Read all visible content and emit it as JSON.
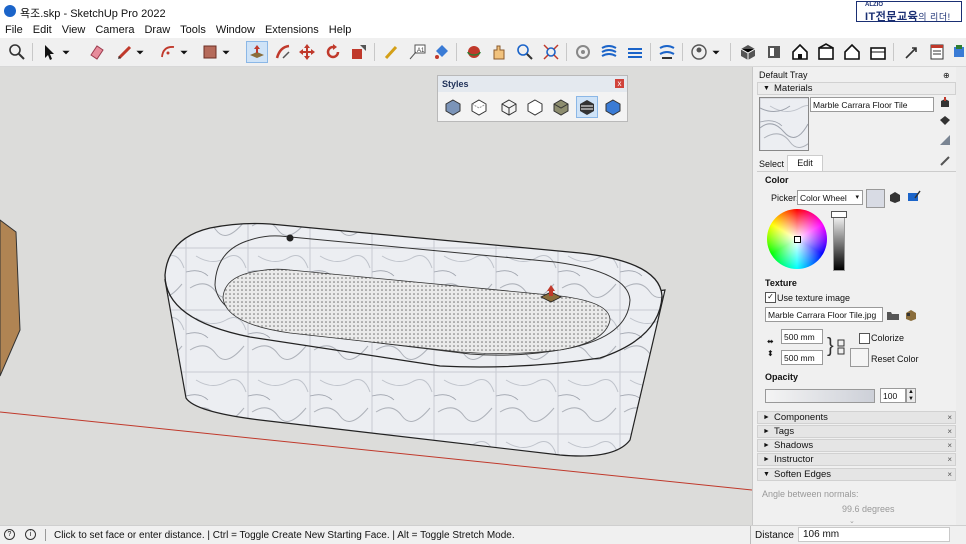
{
  "window": {
    "title": "욕조.skp - SketchUp Pro 2022"
  },
  "brand": {
    "top": "ALZIO",
    "main": "IT전문교육",
    "sub": "의 리더!"
  },
  "menu": [
    "File",
    "Edit",
    "View",
    "Camera",
    "Draw",
    "Tools",
    "Window",
    "Extensions",
    "Help"
  ],
  "toolbar_icons": [
    "zoom-icon",
    "select-icon",
    "eraser-icon",
    "pencil-icon",
    "arc-icon",
    "shape-icon",
    "push-pull-icon",
    "follow-me-icon",
    "move-icon",
    "rotate-icon",
    "scale-icon",
    "tape-measure-icon",
    "text-icon",
    "paint-bucket-icon",
    "orbit-icon",
    "pan-icon",
    "zoom-tool-icon",
    "zoom-extents-icon",
    "sandbox-icon",
    "sandbox-drape-icon",
    "sandbox-stamp-icon",
    "sandbox-flip-icon",
    "profile-icon",
    "iso-view-icon",
    "top-view-icon",
    "front-view-icon",
    "right-view-icon",
    "back-view-icon",
    "left-view-icon",
    "warehouse-icon",
    "extension-icon"
  ],
  "styles_panel": {
    "title": "Styles",
    "close": "x"
  },
  "tray": {
    "title": "Default Tray",
    "pin": "⊕",
    "materials_header": "Materials",
    "material_name": "Marble Carrara Floor Tile",
    "tabs": {
      "select": "Select",
      "edit": "Edit"
    },
    "color_label": "Color",
    "picker_label": "Picker:",
    "picker_value": "Color Wheel",
    "texture_label": "Texture",
    "use_texture": "Use texture image",
    "texture_file": "Marble Carrara Floor Tile.jpg",
    "width": "500 mm",
    "height": "500 mm",
    "colorize": "Colorize",
    "reset_color": "Reset Color",
    "opacity_label": "Opacity",
    "opacity_value": "100",
    "panels": [
      "Components",
      "Tags",
      "Shadows",
      "Instructor",
      "Soften Edges"
    ],
    "soften_label": "Angle between normals:",
    "soften_value": "99.6  degrees"
  },
  "status": {
    "message": "Click to set face or enter distance. | Ctrl = Toggle Create New Starting Face. | Alt = Toggle Stretch Mode.",
    "distance_label": "Distance",
    "distance_value": "106 mm"
  },
  "colors": {
    "accent": "#1b64c9",
    "axis_red": "#c0392b",
    "edit_orange": "#e8741c"
  }
}
